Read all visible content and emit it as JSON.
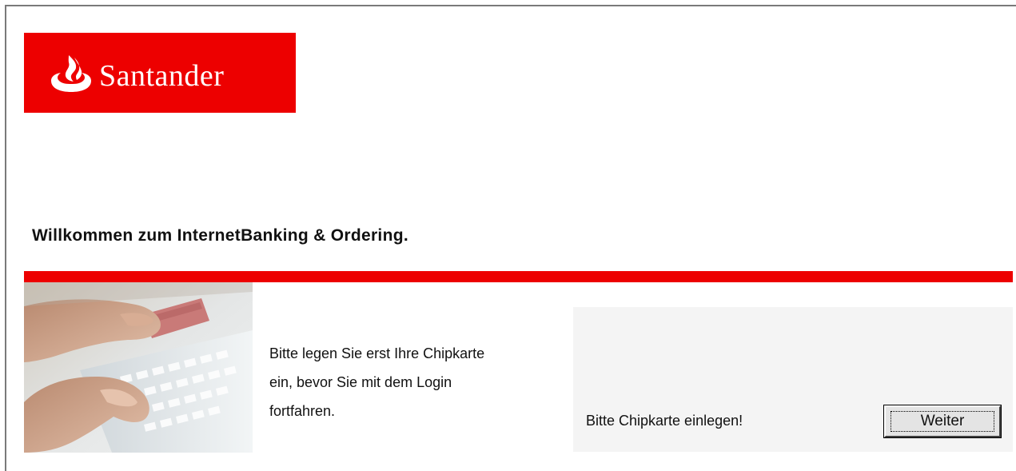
{
  "brand": {
    "name": "Santander",
    "color": "#ed0000",
    "icon": "flame-icon"
  },
  "page": {
    "welcome_heading": "Willkommen zum InternetBanking & Ordering.",
    "instruction_lines": [
      "Bitte legen Sie erst Ihre Chipkarte",
      "ein, bevor Sie mit dem Login",
      "fortfahren."
    ],
    "photo": "hands-keyboard-card-photo"
  },
  "login_panel": {
    "status_text": "Bitte Chipkarte einlegen!",
    "continue_label": "Weiter"
  }
}
